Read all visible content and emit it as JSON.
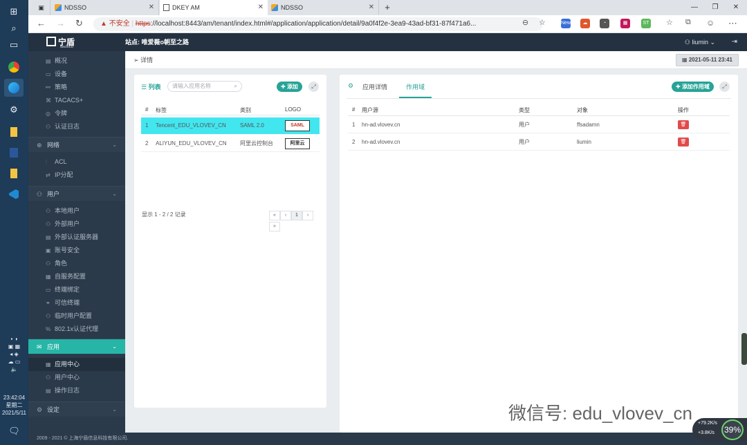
{
  "taskbar": {
    "time": "23:42:04",
    "weekday": "星期二",
    "date": "2021/5/11",
    "icons": [
      "windows-icon",
      "search-icon",
      "task-view-icon",
      "chrome-icon",
      "edge-icon",
      "settings-icon",
      "folder-icon",
      "word-icon",
      "file-icon",
      "vscode-icon"
    ]
  },
  "browser": {
    "tabs": [
      {
        "label": "NDSSO"
      },
      {
        "label": "DKEY AM"
      },
      {
        "label": "NDSSO"
      }
    ],
    "new_tab": "+",
    "insecure_label": "不安全",
    "url_scheme": "https",
    "url_rest": "://localhost:8443/am/tenant/index.html#/application/application/detail/9a0f4f2e-3ea9-43ad-bf31-87f471a6...",
    "extensions": [
      {
        "label": "New",
        "color": "#3a6fd8"
      },
      {
        "label": "",
        "color": "#e0572b"
      },
      {
        "label": "",
        "color": "#555555"
      },
      {
        "label": "",
        "color": "#c2185b"
      },
      {
        "label": "ST",
        "color": "#5cb85c"
      }
    ]
  },
  "header": {
    "logo_text": "宁盾",
    "logo_sub": "NINGDUN",
    "site_title": "站点: 唯爱薇o朝至之路",
    "user": "liumin"
  },
  "sidebar": {
    "items_top": [
      "概况",
      "设备",
      "策略",
      "TACACS+",
      "令牌",
      "认证日志"
    ],
    "group_network": "网络",
    "items_network": [
      "ACL",
      "IP分配"
    ],
    "group_user": "用户",
    "items_user": [
      "本地用户",
      "外部用户",
      "外部认证服务器",
      "账号安全",
      "角色",
      "自服务配置",
      "终端绑定",
      "可信终端",
      "临时用户配置",
      "802.1x认证代理"
    ],
    "group_app": "应用",
    "items_app": [
      "应用中心",
      "用户中心",
      "操作日志"
    ],
    "group_settings": "设定"
  },
  "footer": {
    "text": "2009 - 2021 © 上海宁盾信息科技有限公司."
  },
  "breadcrumb": {
    "label": "详情"
  },
  "datetime": "2021-05-11 23:41",
  "left_panel": {
    "title": "列表",
    "search_placeholder": "请输入应用名称",
    "add_label": "添加",
    "columns": [
      "#",
      "标签",
      "类别",
      "LOGO"
    ],
    "rows": [
      {
        "num": "1",
        "label": "Tencent_EDU_VLOVEV_CN",
        "type": "SAML 2.0",
        "logo": "SAML"
      },
      {
        "num": "2",
        "label": "ALIYUN_EDU_VLOVEV_CN",
        "type": "阿里云控制台",
        "logo": "阿里云"
      }
    ],
    "pager_info": "显示 1 - 2 / 2 记录",
    "pages": [
      "«",
      "‹",
      "1",
      "›",
      "»"
    ]
  },
  "right_panel": {
    "tab_details": "应用详情",
    "tab_scope": "作用域",
    "add_scope_label": "添加作用域",
    "columns": [
      "#",
      "用户源",
      "类型",
      "对象",
      "操作"
    ],
    "rows": [
      {
        "num": "1",
        "source": "hn-ad.vlovev.cn",
        "type": "用户",
        "object": "ffsadamn"
      },
      {
        "num": "2",
        "source": "hn-ad.vlovev.cn",
        "type": "用户",
        "object": "liumin"
      }
    ]
  },
  "watermark": "微信号: edu_vlovev_cn",
  "netmeter": {
    "up": "+79.2K/s",
    "down": "+3.8K/s",
    "percent": "39%"
  }
}
